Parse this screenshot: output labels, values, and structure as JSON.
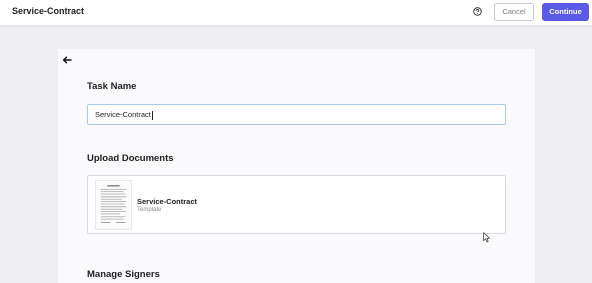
{
  "header": {
    "title": "Service-Contract",
    "help_icon": "help-circle-icon",
    "cancel_label": "Cancel",
    "continue_label": "Continue",
    "accent_color": "#5b5ae6"
  },
  "main": {
    "back_icon": "arrow-left-icon",
    "task_name": {
      "heading": "Task Name",
      "value": "Service-Contract"
    },
    "upload": {
      "heading": "Upload Documents",
      "document": {
        "name": "Service-Contract",
        "type": "Template"
      }
    },
    "signers": {
      "heading": "Manage Signers"
    }
  }
}
